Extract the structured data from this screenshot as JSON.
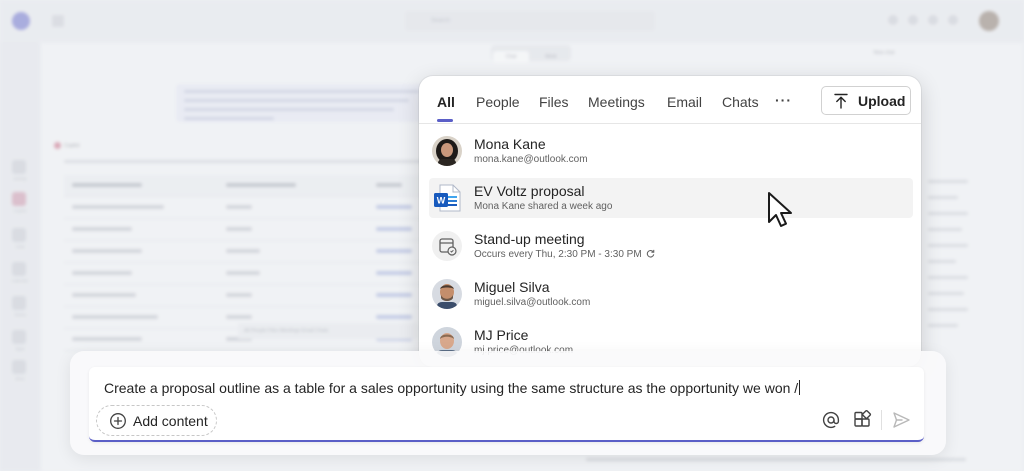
{
  "background": {
    "search_placeholder": "Search",
    "view_tabs": [
      "Chat",
      "Work"
    ],
    "new_chat_label": "New chat",
    "copilot_label": "Copilot",
    "rail_labels": [
      "Activity",
      "Copilot",
      "Chat",
      "Calendar",
      "Teams",
      "Apps",
      "More"
    ],
    "mini_tabs": "All   People   Files   Meetings   Email   Chats"
  },
  "popup": {
    "tabs": [
      "All",
      "People",
      "Files",
      "Meetings",
      "Email",
      "Chats"
    ],
    "more_label": "···",
    "upload_label": "Upload",
    "results": [
      {
        "type": "person",
        "title": "Mona Kane",
        "subtitle": "mona.kane@outlook.com",
        "icon": "avatar-mona-kane"
      },
      {
        "type": "file",
        "title": "EV Voltz proposal",
        "subtitle": "Mona Kane shared a week ago",
        "icon": "word-document-icon"
      },
      {
        "type": "meeting",
        "title": "Stand-up meeting",
        "subtitle": "Occurs every Thu, 2:30 PM - 3:30 PM",
        "icon": "calendar-icon"
      },
      {
        "type": "person",
        "title": "Miguel Silva",
        "subtitle": "miguel.silva@outlook.com",
        "icon": "avatar-miguel-silva"
      },
      {
        "type": "person",
        "title": "MJ Price",
        "subtitle": "mj.price@outlook.com",
        "icon": "avatar-mj-price"
      }
    ]
  },
  "composer": {
    "text": "Create a proposal outline as a table for a sales opportunity using the same structure as the opportunity we won /",
    "add_content_label": "Add content"
  },
  "colors": {
    "accent": "#5b5fc7",
    "word_blue": "#185abd"
  }
}
